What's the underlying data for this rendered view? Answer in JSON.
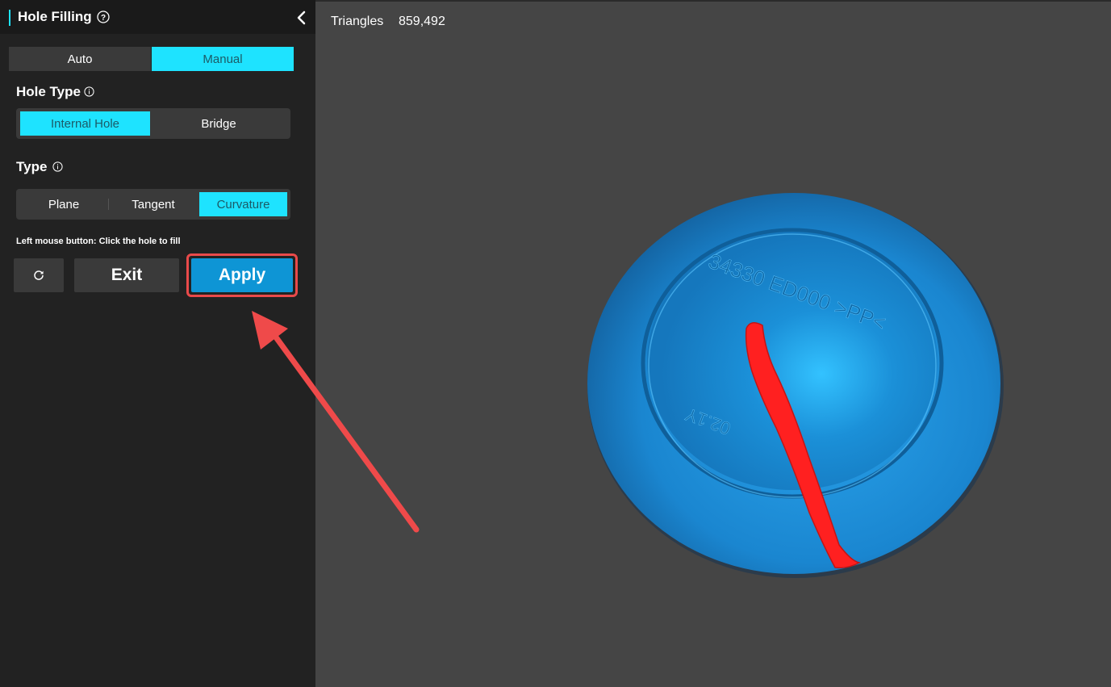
{
  "panel": {
    "title": "Hole Filling",
    "mode_tabs": [
      {
        "label": "Auto",
        "active": false
      },
      {
        "label": "Manual",
        "active": true
      }
    ],
    "hole_type": {
      "label": "Hole Type",
      "options": [
        {
          "label": "Internal Hole",
          "active": true
        },
        {
          "label": "Bridge",
          "active": false
        }
      ]
    },
    "type": {
      "label": "Type",
      "options": [
        {
          "label": "Plane",
          "active": false
        },
        {
          "label": "Tangent",
          "active": false
        },
        {
          "label": "Curvature",
          "active": true
        }
      ]
    },
    "hint": "Left mouse button: Click the hole to fill",
    "buttons": {
      "exit": "Exit",
      "apply": "Apply"
    }
  },
  "viewport": {
    "triangles_label": "Triangles",
    "triangles_value": "859,492",
    "model_embossed_text": "34330 ED000 >PP<",
    "model_embossed_text_2": "02.1Y"
  },
  "colors": {
    "accent": "#1ee3ff",
    "apply_button": "#0e95d5",
    "highlight_frame": "#e94a4a",
    "model_blue": "#1a86d0",
    "selection_red": "#ff2222",
    "panel_bg": "#222222",
    "viewport_bg": "#454545"
  },
  "icons": {
    "help": "question-circle-icon",
    "collapse": "chevron-left-icon",
    "info": "info-circle-icon",
    "reset": "refresh-icon",
    "annotation": "red-arrow-pointing-to-apply"
  }
}
